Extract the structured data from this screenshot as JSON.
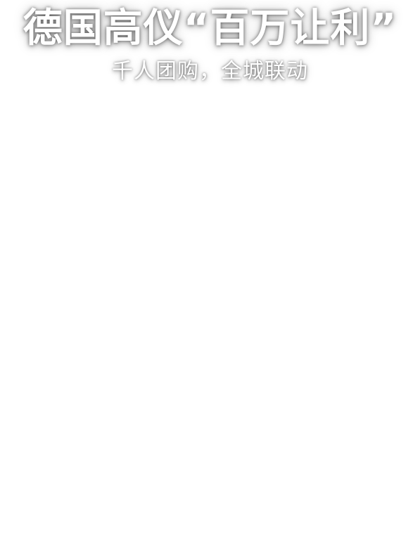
{
  "hero": {
    "headline": "德国高仪“百万让利”",
    "subline": "千人团购，全城联动"
  }
}
